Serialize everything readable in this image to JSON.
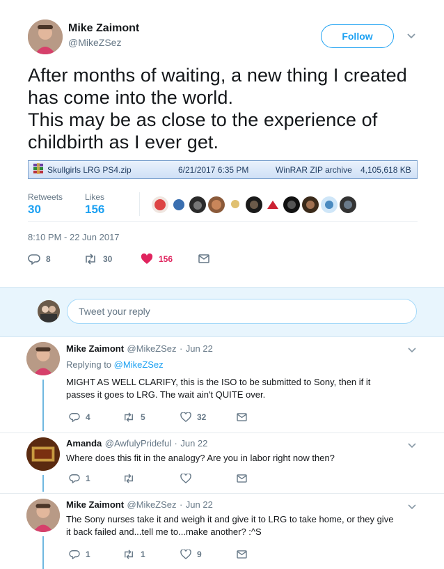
{
  "tweet": {
    "author_name": "Mike Zaimont",
    "author_handle": "@MikeZSez",
    "follow_label": "Follow",
    "text_lines": [
      "After months of waiting, a new thing I created",
      "has come into the world.",
      "This may be as close to the experience of",
      "childbirth as I ever get."
    ],
    "file": {
      "name": "Skullgirls LRG PS4.zip",
      "date": "6/21/2017 6:35 PM",
      "type": "WinRAR ZIP archive",
      "size": "4,105,618 KB"
    },
    "stats": {
      "retweets_label": "Retweets",
      "retweets": "30",
      "likes_label": "Likes",
      "likes": "156"
    },
    "timestamp": "8:10 PM - 22 Jun 2017",
    "actions": {
      "replies": "8",
      "retweets": "30",
      "likes": "156"
    },
    "colors": {
      "accent": "#1da1f2",
      "like": "#e0245e"
    }
  },
  "reply_box": {
    "placeholder": "Tweet your reply"
  },
  "replies": [
    {
      "name": "Mike Zaimont",
      "handle": "@MikeZSez",
      "sep": "·",
      "date": "Jun 22",
      "replying_prefix": "Replying to",
      "replying_to": "@MikeZSez",
      "text_lines": [
        "MIGHT AS WELL CLARIFY, this is the ISO to be submitted to Sony, then if it",
        "passes it goes to LRG.  The wait ain't QUITE over."
      ],
      "replies": "4",
      "retweets": "5",
      "likes": "32"
    },
    {
      "name": "Amanda",
      "handle": "@AwfulyPrideful",
      "sep": "·",
      "date": "Jun 22",
      "text_lines": [
        "Where does this fit in the analogy? Are you in labor right now then?"
      ],
      "replies": "1",
      "retweets": "",
      "likes": ""
    },
    {
      "name": "Mike Zaimont",
      "handle": "@MikeZSez",
      "sep": "·",
      "date": "Jun 22",
      "text_lines": [
        "The Sony nurses take it and weigh it and give it to LRG to take home, or they give",
        "it back failed and...tell me to...make another?  :^S"
      ],
      "replies": "1",
      "retweets": "1",
      "likes": "9"
    }
  ]
}
